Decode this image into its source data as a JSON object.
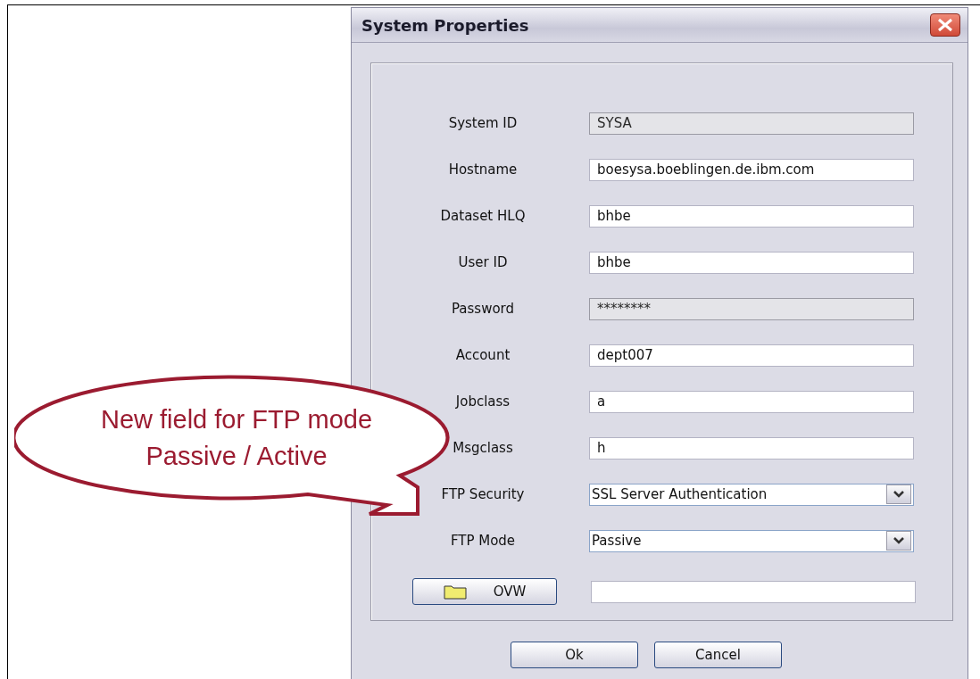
{
  "window": {
    "title": "System Properties"
  },
  "fields": [
    {
      "label": "System ID",
      "kind": "text",
      "value": "SYSA",
      "disabled": true
    },
    {
      "label": "Hostname",
      "kind": "text",
      "value": "boesysa.boeblingen.de.ibm.com",
      "disabled": false
    },
    {
      "label": "Dataset HLQ",
      "kind": "text",
      "value": "bhbe",
      "disabled": false
    },
    {
      "label": "User ID",
      "kind": "text",
      "value": "bhbe",
      "disabled": false
    },
    {
      "label": "Password",
      "kind": "text",
      "value": "********",
      "disabled": true
    },
    {
      "label": "Account",
      "kind": "text",
      "value": "dept007",
      "disabled": false
    },
    {
      "label": "Jobclass",
      "kind": "text",
      "value": "a",
      "disabled": false
    },
    {
      "label": "Msgclass",
      "kind": "text",
      "value": "h",
      "disabled": false
    },
    {
      "label": "FTP Security",
      "kind": "select",
      "value": "SSL Server Authentication"
    },
    {
      "label": "FTP Mode",
      "kind": "select",
      "value": "Passive"
    }
  ],
  "ovw": {
    "label": "OVW"
  },
  "buttons": [
    "Ok",
    "Cancel"
  ],
  "callout": {
    "lines": [
      "New field for FTP mode",
      "Passive / Active"
    ]
  }
}
